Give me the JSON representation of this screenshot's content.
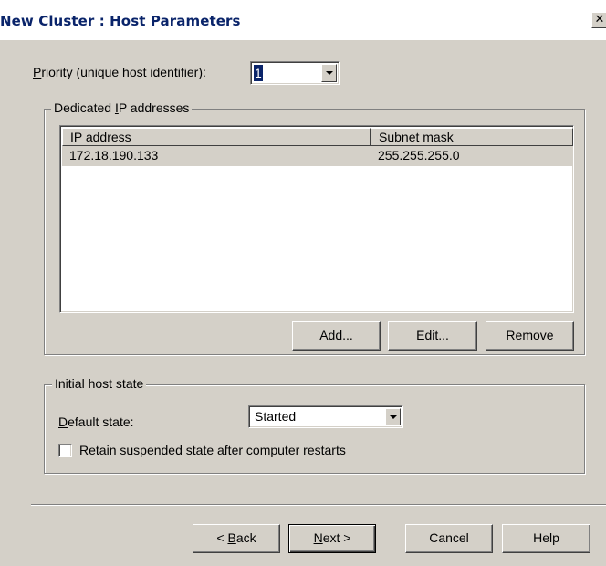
{
  "window": {
    "title": "New Cluster : Host Parameters",
    "close_glyph": "✕"
  },
  "priority": {
    "label_first": "P",
    "label_rest": "riority (unique host identifier):",
    "value": "1"
  },
  "dedicated_ip": {
    "group_pre": "Dedicated ",
    "group_key": "I",
    "group_post": "P addresses",
    "columns": [
      "IP address",
      "Subnet mask"
    ],
    "rows": [
      {
        "ip": "172.18.190.133",
        "mask": "255.255.255.0"
      }
    ],
    "buttons": {
      "add_key": "A",
      "add_rest": "dd...",
      "edit_key": "E",
      "edit_rest": "dit...",
      "remove_key": "R",
      "remove_rest": "emove"
    }
  },
  "host_state": {
    "group_title": "Initial host state",
    "default_label_key": "D",
    "default_label_rest": "efault state:",
    "default_value": "Started",
    "retain_pre": "Re",
    "retain_key": "t",
    "retain_post": "ain suspended state after computer restarts",
    "retain_checked": false
  },
  "footer": {
    "back_pre": "< ",
    "back_key": "B",
    "back_post": "ack",
    "next_key": "N",
    "next_post": "ext >",
    "cancel": "Cancel",
    "help": "Help"
  }
}
